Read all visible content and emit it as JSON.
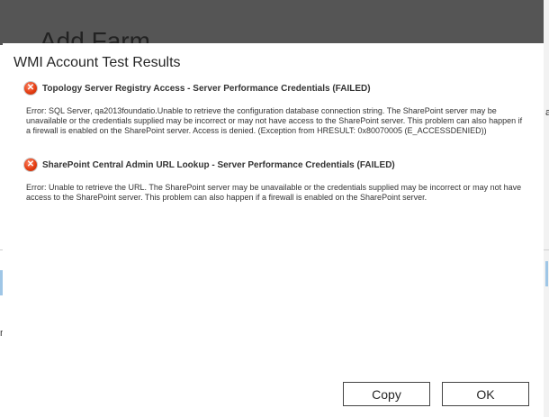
{
  "background": {
    "page_title": "Add Farm",
    "right_marks": [
      "a"
    ],
    "left_marks": [
      "n"
    ]
  },
  "dialog": {
    "title": "WMI Account Test Results",
    "results": [
      {
        "icon": "error-x-icon",
        "title": "Topology Server Registry Access - Server Performance Credentials (FAILED)",
        "message": "Error: SQL Server, qa2013foundatio.Unable to retrieve the configuration database connection string. The SharePoint server may be unavailable or the credentials supplied may be incorrect or may not have access to the SharePoint server. This problem can also happen if a firewall is enabled on the SharePoint server. Access is denied. (Exception from HRESULT: 0x80070005 (E_ACCESSDENIED))"
      },
      {
        "icon": "error-x-icon",
        "title": "SharePoint Central Admin URL Lookup - Server Performance Credentials (FAILED)",
        "message": "Error: Unable to retrieve the URL. The SharePoint server may be unavailable or the credentials supplied may be incorrect or may not have access to the SharePoint server. This problem can also happen if a firewall is enabled on the SharePoint server."
      }
    ],
    "buttons": {
      "copy_label": "Copy",
      "ok_label": "OK"
    }
  },
  "colors": {
    "header_bg": "#555555",
    "error_red": "#e43d12",
    "text": "#333333"
  }
}
